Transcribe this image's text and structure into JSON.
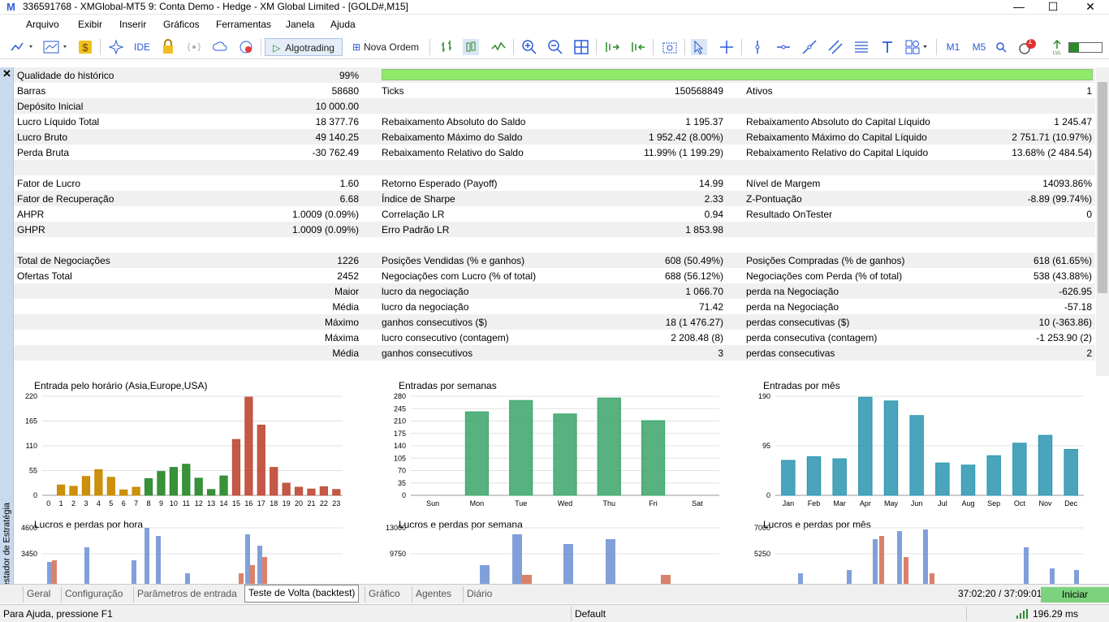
{
  "window": {
    "title": "336591768 - XMGlobal-MT5 9: Conta Demo - Hedge - XM Global Limited - [GOLD#,M15]",
    "logo": "M"
  },
  "menu": [
    "Arquivo",
    "Exibir",
    "Inserir",
    "Gráficos",
    "Ferramentas",
    "Janela",
    "Ajuda"
  ],
  "toolbar": {
    "ide": "IDE",
    "algotrading": "Algotrading",
    "nova_ordem": "Nova Ordem",
    "m1": "M1",
    "m5": "M5",
    "badge": "1"
  },
  "panel": {
    "close": "✕",
    "side_label": "Testador de Estratégia"
  },
  "rows": [
    {
      "c": [
        {
          "l": "Qualidade do histórico",
          "v": "99%"
        }
      ],
      "bar": true
    },
    {
      "c": [
        {
          "l": "Barras",
          "v": "58680"
        },
        {
          "l": "Ticks",
          "v": "150568849"
        },
        {
          "l": "Ativos",
          "v": "1"
        }
      ]
    },
    {
      "c": [
        {
          "l": "Depósito Inicial",
          "v": "10 000.00"
        }
      ]
    },
    {
      "c": [
        {
          "l": "Lucro Líquido Total",
          "v": "18 377.76"
        },
        {
          "l": "Rebaixamento Absoluto do Saldo",
          "v": "1 195.37"
        },
        {
          "l": "Rebaixamento Absoluto do Capital Líquido",
          "v": "1 245.47"
        }
      ]
    },
    {
      "c": [
        {
          "l": "Lucro Bruto",
          "v": "49 140.25"
        },
        {
          "l": "Rebaixamento Máximo do Saldo",
          "v": "1 952.42 (8.00%)"
        },
        {
          "l": "Rebaixamento Máximo do Capital Líquido",
          "v": "2 751.71 (10.97%)"
        }
      ]
    },
    {
      "c": [
        {
          "l": "Perda Bruta",
          "v": "-30 762.49"
        },
        {
          "l": "Rebaixamento Relativo do Saldo",
          "v": "11.99% (1 199.29)"
        },
        {
          "l": "Rebaixamento Relativo do Capital Líquido",
          "v": "13.68% (2 484.54)"
        }
      ]
    },
    {
      "c": []
    },
    {
      "c": [
        {
          "l": "Fator de Lucro",
          "v": "1.60"
        },
        {
          "l": "Retorno Esperado (Payoff)",
          "v": "14.99"
        },
        {
          "l": "Nível de Margem",
          "v": "14093.86%"
        }
      ]
    },
    {
      "c": [
        {
          "l": "Fator de Recuperação",
          "v": "6.68"
        },
        {
          "l": "Índice de Sharpe",
          "v": "2.33"
        },
        {
          "l": "Z-Pontuação",
          "v": "-8.89 (99.74%)"
        }
      ]
    },
    {
      "c": [
        {
          "l": "AHPR",
          "v": "1.0009 (0.09%)"
        },
        {
          "l": "Correlação LR",
          "v": "0.94"
        },
        {
          "l": "Resultado OnTester",
          "v": "0"
        }
      ]
    },
    {
      "c": [
        {
          "l": "GHPR",
          "v": "1.0009 (0.09%)"
        },
        {
          "l": "Erro Padrão LR",
          "v": "1 853.98"
        }
      ]
    },
    {
      "c": []
    },
    {
      "c": [
        {
          "l": "Total de Negociações",
          "v": "1226"
        },
        {
          "l": "Posições Vendidas (% e ganhos)",
          "v": "608 (50.49%)"
        },
        {
          "l": "Posições Compradas (% de ganhos)",
          "v": "618 (61.65%)"
        }
      ]
    },
    {
      "c": [
        {
          "l": "Ofertas Total",
          "v": "2452"
        },
        {
          "l": "Negociações com Lucro (% of total)",
          "v": "688 (56.12%)"
        },
        {
          "l": "Negociações com Perda (% of total)",
          "v": "538 (43.88%)"
        }
      ]
    },
    {
      "p": "Maior",
      "c": [
        {
          "l": "",
          "v": ""
        },
        {
          "l": "lucro da negociação",
          "v": "1 066.70"
        },
        {
          "l": "perda na Negociação",
          "v": "-626.95"
        }
      ]
    },
    {
      "p": "Média",
      "c": [
        {
          "l": "",
          "v": ""
        },
        {
          "l": "lucro da negociação",
          "v": "71.42"
        },
        {
          "l": "perda na Negociação",
          "v": "-57.18"
        }
      ]
    },
    {
      "p": "Máximo",
      "c": [
        {
          "l": "",
          "v": ""
        },
        {
          "l": "ganhos consecutivos ($)",
          "v": "18 (1 476.27)"
        },
        {
          "l": "perdas consecutivas ($)",
          "v": "10 (-363.86)"
        }
      ]
    },
    {
      "p": "Máxima",
      "c": [
        {
          "l": "",
          "v": ""
        },
        {
          "l": "lucro consecutivo (contagem)",
          "v": "2 208.48 (8)"
        },
        {
          "l": "perda consecutiva (contagem)",
          "v": "-1 253.90 (2)"
        }
      ]
    },
    {
      "p": "Média",
      "c": [
        {
          "l": "",
          "v": ""
        },
        {
          "l": "ganhos consecutivos",
          "v": "3"
        },
        {
          "l": "perdas consecutivas",
          "v": "2"
        }
      ]
    },
    {
      "c": []
    }
  ],
  "chart_data": [
    {
      "type": "bar",
      "title": "Entrada pelo horário (Asia,Europe,USA)",
      "categories": [
        "0",
        "1",
        "2",
        "3",
        "4",
        "5",
        "6",
        "7",
        "8",
        "9",
        "10",
        "11",
        "12",
        "13",
        "14",
        "15",
        "16",
        "17",
        "18",
        "19",
        "20",
        "21",
        "22",
        "23"
      ],
      "values": [
        0,
        23,
        20,
        42,
        57,
        40,
        12,
        18,
        37,
        53,
        62,
        69,
        38,
        13,
        43,
        124,
        218,
        156,
        62,
        27,
        18,
        14,
        19,
        13
      ],
      "ylim": [
        0,
        220
      ],
      "yticks": [
        "0",
        "55",
        "110",
        "165",
        "220"
      ],
      "colors": [
        "#c98a00",
        "#2e8b2e",
        "#c0503c"
      ]
    },
    {
      "type": "bar",
      "title": "Entradas por semanas",
      "categories": [
        "Sun",
        "Mon",
        "Tue",
        "Wed",
        "Thu",
        "Fri",
        "Sat"
      ],
      "values": [
        0,
        236,
        268,
        230,
        275,
        211,
        0
      ],
      "ylim": [
        0,
        280
      ],
      "yticks": [
        "0",
        "35",
        "70",
        "105",
        "140",
        "175",
        "210",
        "245",
        "280"
      ],
      "color": "#3aa56a"
    },
    {
      "type": "bar",
      "title": "Entradas por mês",
      "categories": [
        "Jan",
        "Feb",
        "Mar",
        "Apr",
        "May",
        "Jun",
        "Jul",
        "Aug",
        "Sep",
        "Oct",
        "Nov",
        "Dec"
      ],
      "values": [
        67,
        74,
        70,
        188,
        181,
        153,
        62,
        58,
        76,
        100,
        115,
        88
      ],
      "ylim": [
        0,
        190
      ],
      "yticks": [
        "0",
        "95",
        "190"
      ],
      "color": "#2a95b0"
    },
    {
      "type": "bar",
      "title": "Lucros e perdas por hora",
      "ylim": [
        2200,
        4600
      ],
      "yticks": [
        "3450",
        "4600"
      ],
      "profit": [
        0,
        0,
        0,
        0,
        0,
        0,
        0,
        0,
        0,
        0,
        0,
        0,
        0,
        0,
        0,
        0,
        0,
        0,
        0,
        0,
        0,
        0,
        0,
        0
      ],
      "loss": [
        0,
        0,
        0,
        0,
        0,
        0,
        0,
        0,
        0,
        0,
        0,
        0,
        0,
        0,
        0,
        0,
        0,
        0,
        0,
        0,
        0,
        0,
        0,
        0
      ],
      "profit_color": "#6b8fd4",
      "loss_color": "#d46b50"
    },
    {
      "type": "bar",
      "title": "Lucros e perdas por semana",
      "ylim": [
        6500,
        13000
      ],
      "yticks": [
        "9750",
        "13000"
      ],
      "profit_color": "#6b8fd4",
      "loss_color": "#d46b50"
    },
    {
      "type": "bar",
      "title": "Lucros e perdas por mês",
      "ylim": [
        3500,
        7000
      ],
      "yticks": [
        "5250",
        "7000"
      ],
      "profit_color": "#6b8fd4",
      "loss_color": "#d46b50"
    }
  ],
  "tabs": [
    "Geral",
    "Configuração",
    "Parâmetros de entrada",
    "Teste de Volta (backtest)",
    "Gráfico",
    "Agentes",
    "Diário"
  ],
  "time_info": "37:02:20 / 37:09:01",
  "iniciar": "Iniciar",
  "status": {
    "help": "Para Ajuda, pressione F1",
    "profile": "Default",
    "ping": "196.29 ms"
  }
}
